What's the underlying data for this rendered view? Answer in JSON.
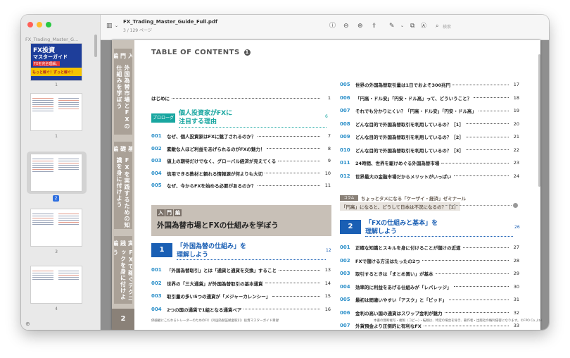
{
  "window": {
    "colors": {
      "close": "#ff5f57",
      "minimize": "#febc2e",
      "zoom": "#28c840"
    }
  },
  "sidebar": {
    "title": "FX_Trading_Master_G...",
    "thumbnails": [
      {
        "label": "1",
        "title_lines": [
          "FX投資",
          "マスターガイド",
          "FXを完全理解。",
          "もっと稼ぐ！ずっと稼ぐ！"
        ]
      },
      {
        "label": "1"
      },
      {
        "label": "2",
        "selected": true
      },
      {
        "label": "3"
      },
      {
        "label": "4"
      }
    ]
  },
  "toolbar": {
    "title": "FX_Trading_Master_Guide_Full.pdf",
    "subtitle": "3 / 129 ページ",
    "search_placeholder": "検索",
    "icons": [
      "sidebar-icon",
      "chevron-down-icon",
      "info-icon",
      "zoom-out-icon",
      "zoom-in-icon",
      "share-icon",
      "markup-pen-icon",
      "chevron-down-icon",
      "rotate-icon",
      "annotate-icon",
      "search-icon"
    ]
  },
  "spine": {
    "section1_tag": "入門編",
    "section1_text": "外国為替市場とFXの仕組みを学ぼう",
    "section2_tag": "基礎編",
    "section2_text": "FXを実践するための知識を身に付けよう",
    "section3_tag": "実践編",
    "section3_text": "FXで稼ぐテクニックを身に付けよう",
    "page_number": "2"
  },
  "toc": {
    "heading": "TABLE OF CONTENTS",
    "heading_num": "1",
    "intro": {
      "title": "はじめに",
      "page": "1"
    },
    "prologue": {
      "tag": "プロローグ",
      "title_line1": "個人投資家がFXに",
      "title_line2": "注目する理由",
      "page": "6"
    },
    "prologue_items": [
      {
        "num": "001",
        "title": "なぜ、個人投資家はFXに魅了されるのか？",
        "page": "7"
      },
      {
        "num": "002",
        "title": "素敵な人ほど利益をあげられるのがFXの魅力！",
        "page": "8"
      },
      {
        "num": "003",
        "title": "値上の期待だけでなく、グローバル経済が見えてくる",
        "page": "9"
      },
      {
        "num": "004",
        "title": "信用できる教材と頼れる情報源が何よりも大切",
        "page": "10"
      },
      {
        "num": "005",
        "title": "なぜ、今からFXを始める必要があるのか？",
        "page": "11"
      }
    ],
    "part": {
      "tag": [
        "入",
        "門",
        "編"
      ],
      "title": "外国為替市場とFXの仕組みを学ぼう"
    },
    "chapter1": {
      "badge": "1",
      "title_line1": "「外国為替の仕組み」を",
      "title_line2": "理解しよう",
      "page": "12"
    },
    "chapter1_items": [
      {
        "num": "001",
        "title": "「外国為替取引」とは「通貨と通貨を交換」すること",
        "page": "13"
      },
      {
        "num": "002",
        "title": "世界の「三大通貨」が外国為替取引の基本通貨",
        "page": "14"
      },
      {
        "num": "003",
        "title": "取引量の多い5つの通貨が「メジャーカレンシー」",
        "page": "15"
      },
      {
        "num": "004",
        "title": "2つの国の通貨で1組となる通貨ペア",
        "page": "16"
      }
    ],
    "right_items": [
      {
        "num": "005",
        "title": "世界の外国為替取引量は1日でおよそ300兆円",
        "page": "17"
      },
      {
        "num": "006",
        "title": "「円高・ドル安」「円安・ドル高」って、どういうこと？",
        "page": "18"
      },
      {
        "num": "007",
        "title": "それでも分かりにくい？「円高・ドル安」「円安・ドル高」",
        "page": "19"
      },
      {
        "num": "008",
        "title": "どんな目的で外国為替取引を利用しているの？［1］",
        "page": "20"
      },
      {
        "num": "009",
        "title": "どんな目的で外国為替取引を利用しているの？［2］",
        "page": "21"
      },
      {
        "num": "010",
        "title": "どんな目的で外国為替取引を利用しているの？［3］",
        "page": "22"
      },
      {
        "num": "011",
        "title": "24時間、世界を駆けめぐる外国為替市場",
        "page": "23"
      },
      {
        "num": "012",
        "title": "世界最大の金融市場だからメリットがいっぱい",
        "page": "24"
      }
    ],
    "column": {
      "tag": "コラム",
      "title": "ちょっとタメになる「ケーザイ・経済」ゼミナール",
      "subtitle": "「円高」になると、どうして日本は不況になるの？［1］"
    },
    "chapter2": {
      "badge": "2",
      "title_line1": "「FXの仕組みと基本」を",
      "title_line2": "理解しよう",
      "page": "26"
    },
    "chapter2_items": [
      {
        "num": "001",
        "title": "正確な知識とスキルを身に付けることが儲けの近道",
        "page": "27"
      },
      {
        "num": "002",
        "title": "FXで儲ける方法はたったの2つ",
        "page": "28"
      },
      {
        "num": "003",
        "title": "取引するときは「まとめ買い」が基本",
        "page": "29"
      },
      {
        "num": "004",
        "title": "効率的に利益をあげる仕組みが「レバレッジ」",
        "page": "30"
      },
      {
        "num": "005",
        "title": "最初は間違いやすい「アスク」と「ビッド」",
        "page": "31"
      },
      {
        "num": "006",
        "title": "金利の高い国の通貨はスワップ金利が魅力",
        "page": "32"
      },
      {
        "num": "007",
        "title": "外貨預金より圧倒的に有利なFX",
        "page": "33"
      }
    ],
    "footer_left": "価値観にこだわるトレーダーのためのFX（外国為替証拠金取引）投資マスターガイド目録",
    "footer_right": "本書の無断複写・複製（コピー）・転載は、特定の場合を除き、著作者・出版社の権利侵害になります。©FPO Co.,Ltd."
  }
}
